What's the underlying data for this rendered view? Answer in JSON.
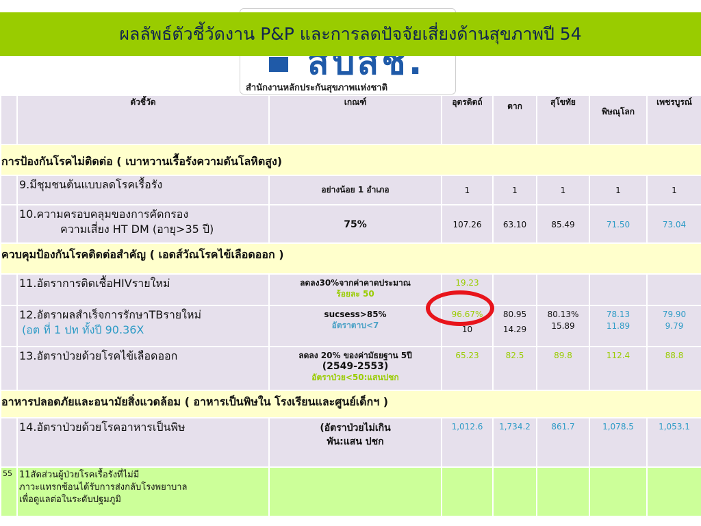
{
  "logo": {
    "mark": "สปสช.",
    "caption": "สำนักงานหลักประกันสุขภาพแห่งชาติ"
  },
  "title": "ผลลัพธ์ตัวชี้วัดงาน P&P และการลดปัจจัยเสี่ยงด้านสุขภาพปี 54",
  "headers": [
    "",
    "ตัวชี้วัด",
    "เกณฑ์",
    "อุตรดิตถ์",
    "ตาก",
    "สุโขทัย",
    "พิษณุโลก",
    "เพชรบูรณ์"
  ],
  "sections": {
    "s1": "การป้องกันโรคไม่ติดต่อ  ( เบาหวานเรื้อรังความดันโลหิตสูง)",
    "s2": "ควบคุมป้องกันโรคติดต่อสำคัญ ( เอดส์วัณโรคไข้เลือดออก )",
    "s3": "อาหารปลอดภัยและอนามัยสิ่งแวดล้อม  (  อาหารเป็นพิษใน โรงเรียนและศูนย์เด็กฯ )"
  },
  "rows": {
    "r9": {
      "indicator": "9.มีชุมชนต้นแบบลดโรคเรื้อรัง",
      "criteria": "อย่างน้อย  1 อำเภอ",
      "values": [
        "1",
        "1",
        "1",
        "1",
        "1"
      ]
    },
    "r10": {
      "indicator_line1": "10.ความครอบคลุมของการคัดกรอง",
      "indicator_line2": "ความเสี่ยง  HT DM (อายุ>35 ปี)",
      "criteria": "75%",
      "values": [
        "107.26",
        "63.10",
        "85.49",
        "71.50",
        "73.04"
      ]
    },
    "r11": {
      "indicator": "11.อัตราการติดเชื้อHIVรายใหม่",
      "criteria_line1": "ลดลง30%จากค่าคาดประมาณ",
      "criteria_line2": "ร้อยละ 50",
      "values": [
        "19.23",
        "",
        "",
        "",
        ""
      ]
    },
    "r12": {
      "indicator_line1": "12.อัตราผลสำเร็จการรักษาTBรายใหม่",
      "indicator_line2": "(อต ที่ 1 ปท ทั้งปี 90.36X",
      "criteria_line1": "sucsess>85%",
      "criteria_line2": "อัตราตาบ<7",
      "values1": [
        "96.67%",
        "80.95",
        "80.13%",
        "78.13",
        "79.90"
      ],
      "values2": [
        "10",
        "14.29",
        "15.89",
        "11.89",
        "9.79"
      ]
    },
    "r13": {
      "indicator": "13.อัตราป่วยด้วยโรคไข้เลือดออก",
      "criteria_line1": "ลดลง 20% ของค่ามัธยฐาน 5ปี",
      "criteria_line2": "(2549-2553)",
      "criteria_line3": "อัตราป่วย<50:แสนปชก",
      "values": [
        "65.23",
        "82.5",
        "89.8",
        "112.4",
        "88.8"
      ]
    },
    "r14": {
      "indicator": "14.อัตราป่วยด้วยโรคอาหารเป็นพิษ",
      "criteria_line1": "(อัตราป่วยไม่เกิน",
      "criteria_line2": "พัน:แสน ปชก",
      "values": [
        "1,012.6",
        "1,734.2",
        "861.7",
        "1,078.5",
        "1,053.1"
      ]
    },
    "r11b": {
      "number": "55",
      "indicator_line1": "11สัดส่วนผู้ป่วยโรคเรื้อรังที่ไม่มี",
      "indicator_line2": "ภาวะแทรกซ้อนได้รับการส่งกลับโรงพยาบาล",
      "indicator_line3": "เพื่อดูแลต่อในระดับปฐมภูมิ"
    }
  },
  "colors": {
    "title_bg": "#99cc00",
    "section_bg": "#ffffcc",
    "row_bg": "#e6e0ec",
    "last_row_bg": "#ccff99",
    "highlight": "#e8141b"
  }
}
